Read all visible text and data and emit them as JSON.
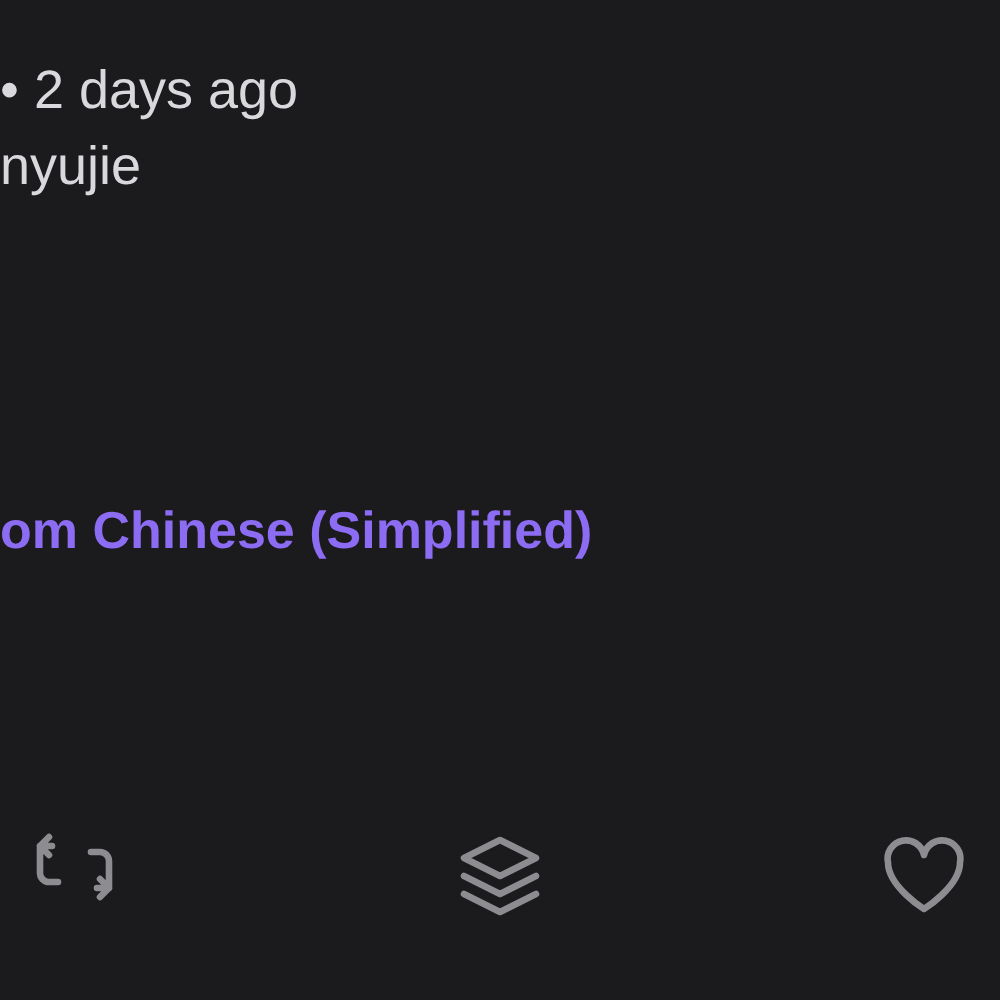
{
  "post": {
    "meta": "• 2 days ago",
    "author": "nyujie",
    "translation_link": "om Chinese (Simplified)"
  },
  "actions": [
    {
      "kind": "repost"
    },
    {
      "kind": "layers"
    },
    {
      "kind": "like"
    }
  ]
}
